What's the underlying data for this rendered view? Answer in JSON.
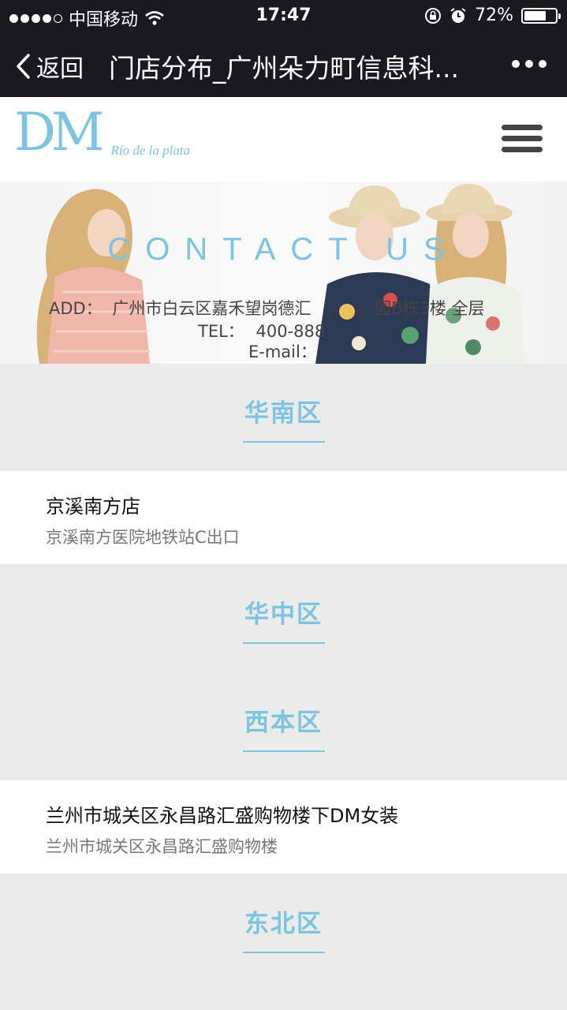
{
  "status_bar": {
    "carrier": "中国移动",
    "time": "17:47",
    "battery": "72%",
    "battery_level": 0.72
  },
  "nav_bar": {
    "back_label": "返回",
    "title": "门店分布_广州朵力町信息科...",
    "more_icon": "more-dots-icon"
  },
  "site_header": {
    "logo_text": "DM",
    "logo_tagline": "Río de la plata",
    "menu_icon": "hamburger-menu-icon"
  },
  "banner": {
    "heading": "CONTACT US",
    "add_label": "ADD：",
    "add_value": "广州市白云区嘉禾望岗德汇",
    "add_tail": "园B栋3楼 全层",
    "tel_label": "TEL：",
    "tel_value": "400-888",
    "email_label": "E-mail："
  },
  "sections": [
    {
      "title": "华南区"
    },
    {
      "title": "华中区"
    },
    {
      "title": "西本区"
    },
    {
      "title": "东北区"
    }
  ],
  "stores": [
    {
      "name": "京溪南方店",
      "address": "京溪南方医院地铁站C出口"
    },
    {
      "name": "兰州市城关区永昌路汇盛购物楼下DM女装",
      "address": "兰州市城关区永昌路汇盛购物楼"
    }
  ],
  "colors": {
    "accent": "#7cc4e0",
    "bar": "#1a1a1e",
    "page_bg": "#ebebeb"
  }
}
